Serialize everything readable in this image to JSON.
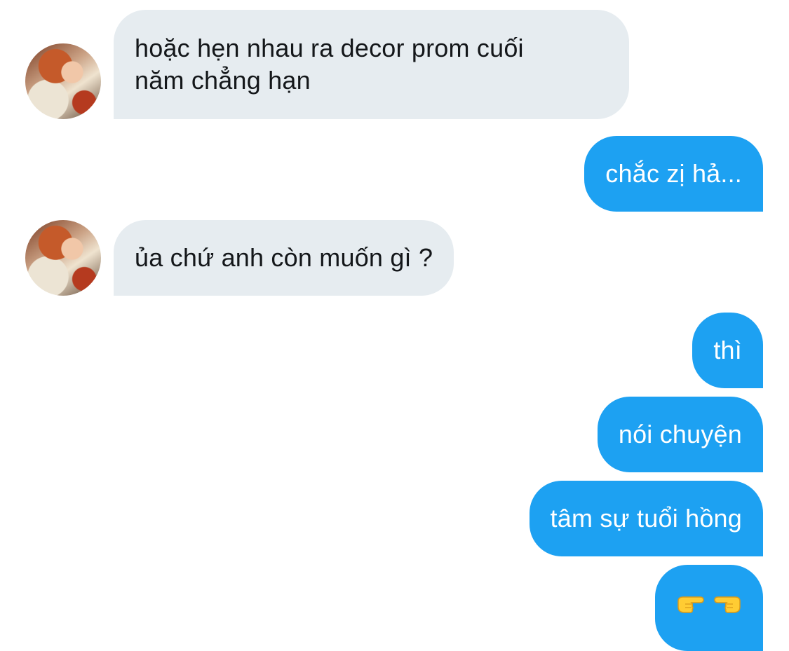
{
  "conversation": {
    "messages": [
      {
        "from": "other",
        "text_line1": "hoặc hẹn nhau ra decor prom cuối",
        "text_line2": "năm chẳng hạn"
      },
      {
        "from": "me",
        "text": "chắc zị hả..."
      },
      {
        "from": "other",
        "text": "ủa chứ anh còn muốn gì ?"
      },
      {
        "from": "me",
        "text": "thì"
      },
      {
        "from": "me",
        "text": "nói chuyện"
      },
      {
        "from": "me",
        "text": "tâm sự tuổi hồng"
      },
      {
        "from": "me",
        "emoji": [
          "backhand-index-pointing-right",
          "backhand-index-pointing-left"
        ]
      }
    ]
  },
  "colors": {
    "sent_bubble": "#1da1f2",
    "received_bubble": "#e6ecf0",
    "received_text": "#14171a",
    "sent_text": "#ffffff"
  }
}
